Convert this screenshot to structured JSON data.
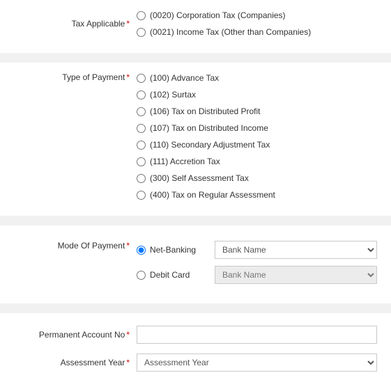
{
  "taxApplicable": {
    "label": "Tax Applicable",
    "options": [
      "(0020) Corporation Tax (Companies)",
      "(0021) Income Tax (Other than Companies)"
    ]
  },
  "typeOfPayment": {
    "label": "Type of Payment",
    "options": [
      "(100) Advance Tax",
      "(102) Surtax",
      "(106) Tax on Distributed Profit",
      "(107) Tax on Distributed Income",
      "(110) Secondary Adjustment Tax",
      "(111) Accretion Tax",
      "(300) Self Assessment Tax",
      "(400) Tax on Regular Assessment"
    ]
  },
  "modeOfPayment": {
    "label": "Mode Of Payment",
    "netBanking": "Net-Banking",
    "debitCard": "Debit Card",
    "bankPlaceholder": "Bank Name"
  },
  "pan": {
    "label": "Permanent Account No"
  },
  "asmtYear": {
    "label": "Assessment Year",
    "placeholder": "Assessment Year"
  }
}
